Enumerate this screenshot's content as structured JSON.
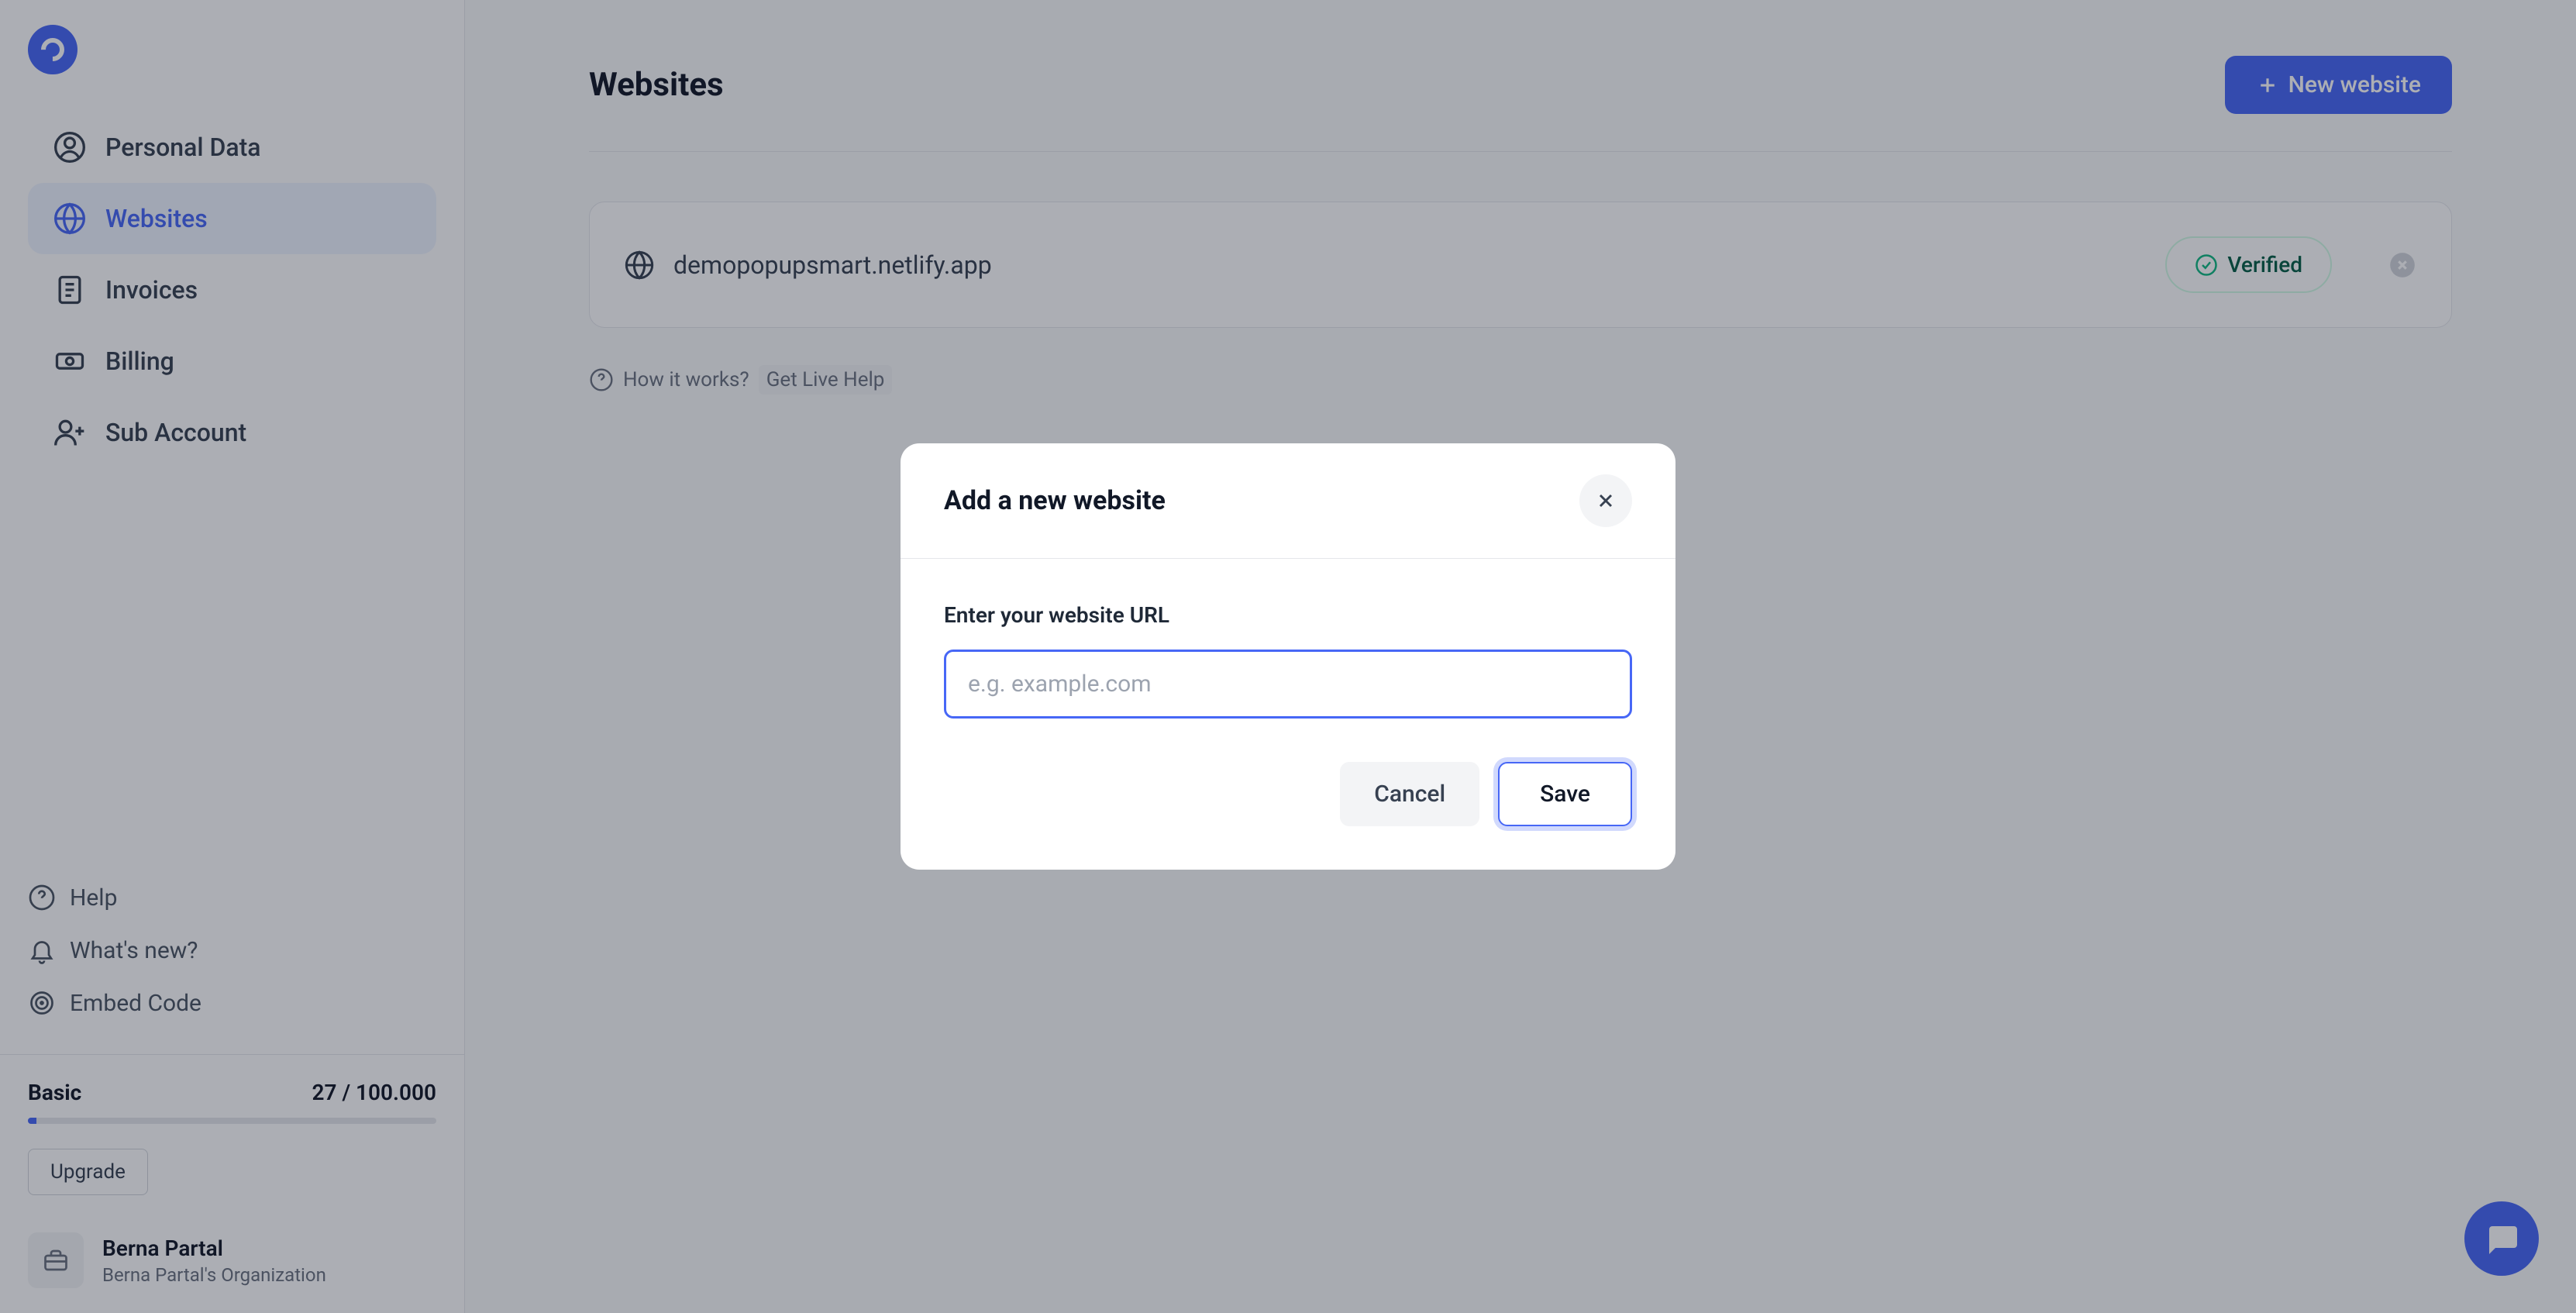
{
  "sidebar": {
    "nav": [
      {
        "label": "Personal Data"
      },
      {
        "label": "Websites"
      },
      {
        "label": "Invoices"
      },
      {
        "label": "Billing"
      },
      {
        "label": "Sub Account"
      }
    ],
    "bottom": [
      {
        "label": "Help"
      },
      {
        "label": "What's new?"
      },
      {
        "label": "Embed Code"
      }
    ],
    "plan": {
      "name": "Basic",
      "usage": "27 / 100.000",
      "upgrade_label": "Upgrade"
    },
    "user": {
      "name": "Berna Partal",
      "org": "Berna Partal's Organization"
    }
  },
  "main": {
    "title": "Websites",
    "new_button": "New website",
    "websites": [
      {
        "url": "demopopupsmart.netlify.app",
        "status": "Verified"
      }
    ],
    "help_text": "How it works?",
    "live_help": "Get Live Help"
  },
  "modal": {
    "title": "Add a new website",
    "input_label": "Enter your website URL",
    "placeholder": "e.g. example.com",
    "cancel": "Cancel",
    "save": "Save"
  }
}
